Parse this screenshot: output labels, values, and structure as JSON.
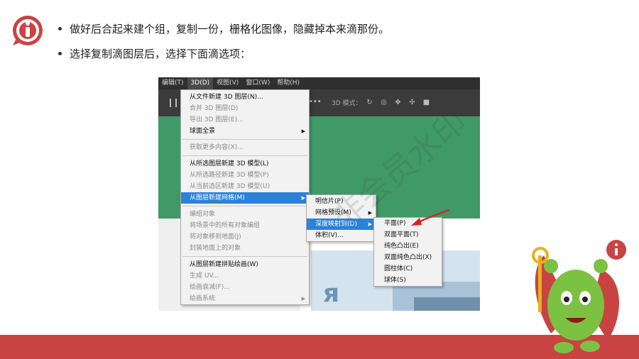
{
  "bullets": [
    "做好后合起来建个组，复制一份，栅格化图像，隐藏掉本来滴那份。",
    "选择复制滴图层后，选择下面滴选项："
  ],
  "menubar": [
    "编辑(T)",
    "3D(D)",
    "视图(V)",
    "窗口(W)",
    "帮助(H)"
  ],
  "optbar": {
    "mode_label": "3D 模式：",
    "dots": "•••"
  },
  "menu_3d": {
    "items": [
      "从文件新建 3D 图层(N)...",
      "合并 3D 图层(D)",
      "导出 3D 图层(E)...",
      "球面全景",
      "获取更多内容(X)...",
      "从所选图层新建 3D 模型(L)",
      "从所选路径新建 3D 模型(P)",
      "从当前选区新建 3D 模型(U)",
      "从图层新建网格(M)",
      "编组对象",
      "将场景中的所有对象编组",
      "将对象移到地面(J)",
      "封装地面上的对象",
      "从图层新建拼贴绘画(W)",
      "生成 UV...",
      "绘画衰减(F)...",
      "绘画系统"
    ]
  },
  "menu_mesh": {
    "items": [
      "明信片(P)",
      "网格预设(M)",
      "深度映射到(D)",
      "体积(V)..."
    ]
  },
  "menu_depth": {
    "items": [
      "平面(P)",
      "双面平面(T)",
      "纯色凸出(E)",
      "双面纯色凸出(X)",
      "圆柱体(C)",
      "球体(S)"
    ]
  },
  "canvas": {
    "big_letter": "я"
  },
  "watermark": "非会员水印",
  "colors": {
    "accent_red": "#c94343",
    "canvas_green": "#3f9a68",
    "menu_highlight": "#2a82da"
  }
}
